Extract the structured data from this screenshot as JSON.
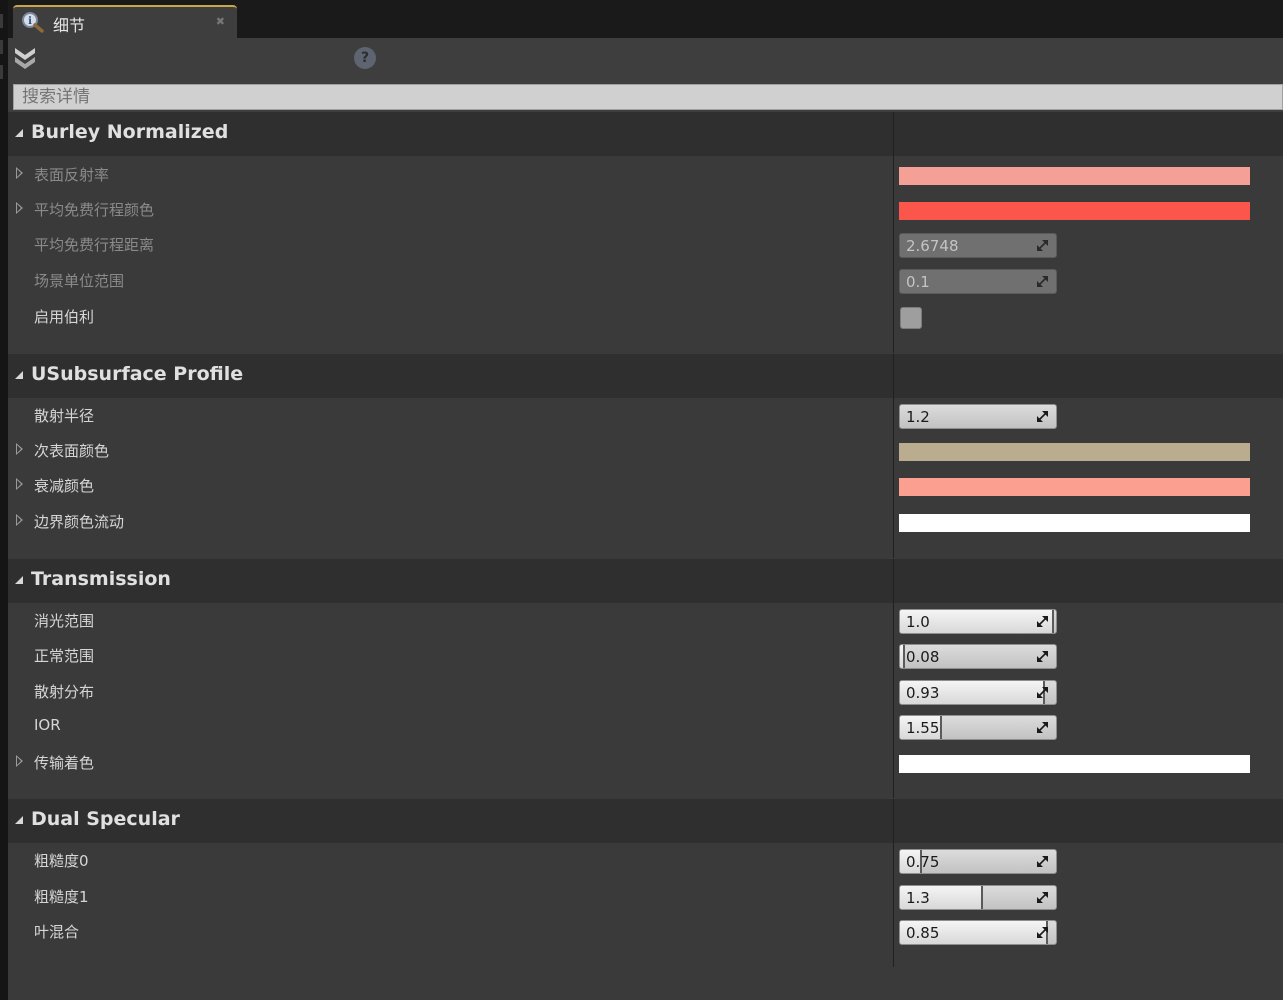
{
  "tab": {
    "title": "细节",
    "icon": "details-magnifier-icon"
  },
  "toolbar": {
    "view_icon": "view-options-icon",
    "help_icon": "help-icon",
    "help_glyph": "?"
  },
  "search": {
    "placeholder": "搜索详情",
    "value": ""
  },
  "sections": {
    "burley": {
      "title": "Burley Normalized",
      "surface_albedo": {
        "label": "表面反射率",
        "color": "#f4a096"
      },
      "mfp_color": {
        "label": "平均免费行程颜色",
        "color": "#fb564c"
      },
      "mfp_distance": {
        "label": "平均免费行程距离",
        "value": "2.6748"
      },
      "world_unit_scale": {
        "label": "场景单位范围",
        "value": "0.1"
      },
      "enable_burley": {
        "label": "启用伯利",
        "checked": false
      }
    },
    "subsurface": {
      "title": "USubsurface Profile",
      "scatter_radius": {
        "label": "散射半径",
        "value": "1.2"
      },
      "subsurface_color": {
        "label": "次表面颜色",
        "color": "#baad8f"
      },
      "falloff_color": {
        "label": "衰减颜色",
        "color": "#fb9f91"
      },
      "boundary_bleed": {
        "label": "边界颜色流动",
        "color": "#ffffff"
      }
    },
    "transmission": {
      "title": "Transmission",
      "extinction_scale": {
        "label": "消光范围",
        "value": "1.0",
        "fill": 0.99
      },
      "normal_scale": {
        "label": "正常范围",
        "value": "0.08",
        "fill": 0.03
      },
      "scattering_distribution": {
        "label": "散射分布",
        "value": "0.93",
        "fill": 0.93
      },
      "ior": {
        "label": "IOR",
        "value": "1.55",
        "fill": 0.27
      },
      "transmission_tint": {
        "label": "传输着色",
        "color": "#ffffff"
      }
    },
    "dual_specular": {
      "title": "Dual Specular",
      "roughness0": {
        "label": "粗糙度0",
        "value": "0.75",
        "fill": 0.14
      },
      "roughness1": {
        "label": "粗糙度1",
        "value": "1.3",
        "fill": 0.53
      },
      "lobe_mix": {
        "label": "叶混合",
        "value": "0.85",
        "fill": 0.95
      }
    }
  },
  "colors": {
    "tab_accent": "#c9a646",
    "panel_bg": "#3a3a3a",
    "header_bg": "#2f2f2f"
  }
}
